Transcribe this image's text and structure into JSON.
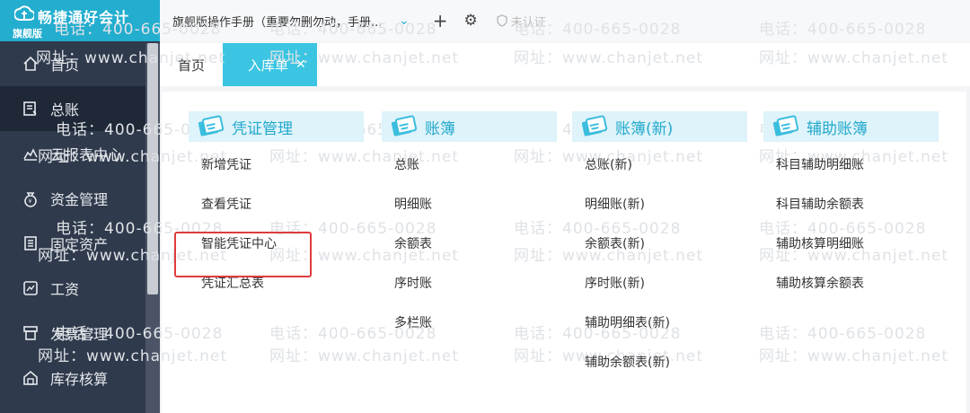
{
  "app": {
    "brand_name": "畅捷通好会计",
    "edition": "旗舰版"
  },
  "sidebar": {
    "items": [
      {
        "label": "首页",
        "icon": "home-icon"
      },
      {
        "label": "总账",
        "icon": "ledger-icon",
        "active": true
      },
      {
        "label": "云报表中心",
        "icon": "chart-icon"
      },
      {
        "label": "资金管理",
        "icon": "money-bag-icon"
      },
      {
        "label": "固定资产",
        "icon": "building-icon"
      },
      {
        "label": "工资",
        "icon": "salary-icon"
      },
      {
        "label": "发票管理",
        "icon": "invoice-icon"
      },
      {
        "label": "库存核算",
        "icon": "warehouse-icon"
      }
    ]
  },
  "topbar": {
    "manual_title": "旗舰版操作手册（重要勿删勿动，手册...",
    "unverified": "未认证"
  },
  "tabs": [
    {
      "label": "首页"
    },
    {
      "label": "入库单",
      "active": true
    }
  ],
  "watermark": {
    "phone": "电话：400-665-0028",
    "site": "网址：www.chanjet.net"
  },
  "menu": [
    {
      "title": "凭证管理",
      "items": [
        "新增凭证",
        "查看凭证",
        "智能凭证中心",
        "凭证汇总表"
      ]
    },
    {
      "title": "账簿",
      "items": [
        "总账",
        "明细账",
        "余额表",
        "序时账",
        "多栏账"
      ]
    },
    {
      "title": "账簿(新)",
      "items": [
        "总账(新)",
        "明细账(新)",
        "余额表(新)",
        "序时账(新)",
        "辅助明细表(新)",
        "辅助余额表(新)"
      ]
    },
    {
      "title": "辅助账簿",
      "items": [
        "科目辅助明细账",
        "科目辅助余额表",
        "辅助核算明细账",
        "辅助核算余额表"
      ]
    }
  ],
  "colors": {
    "accent": "#23adcf",
    "sidebar_bg": "#2f3a4c",
    "highlight": "#e03b3b"
  }
}
